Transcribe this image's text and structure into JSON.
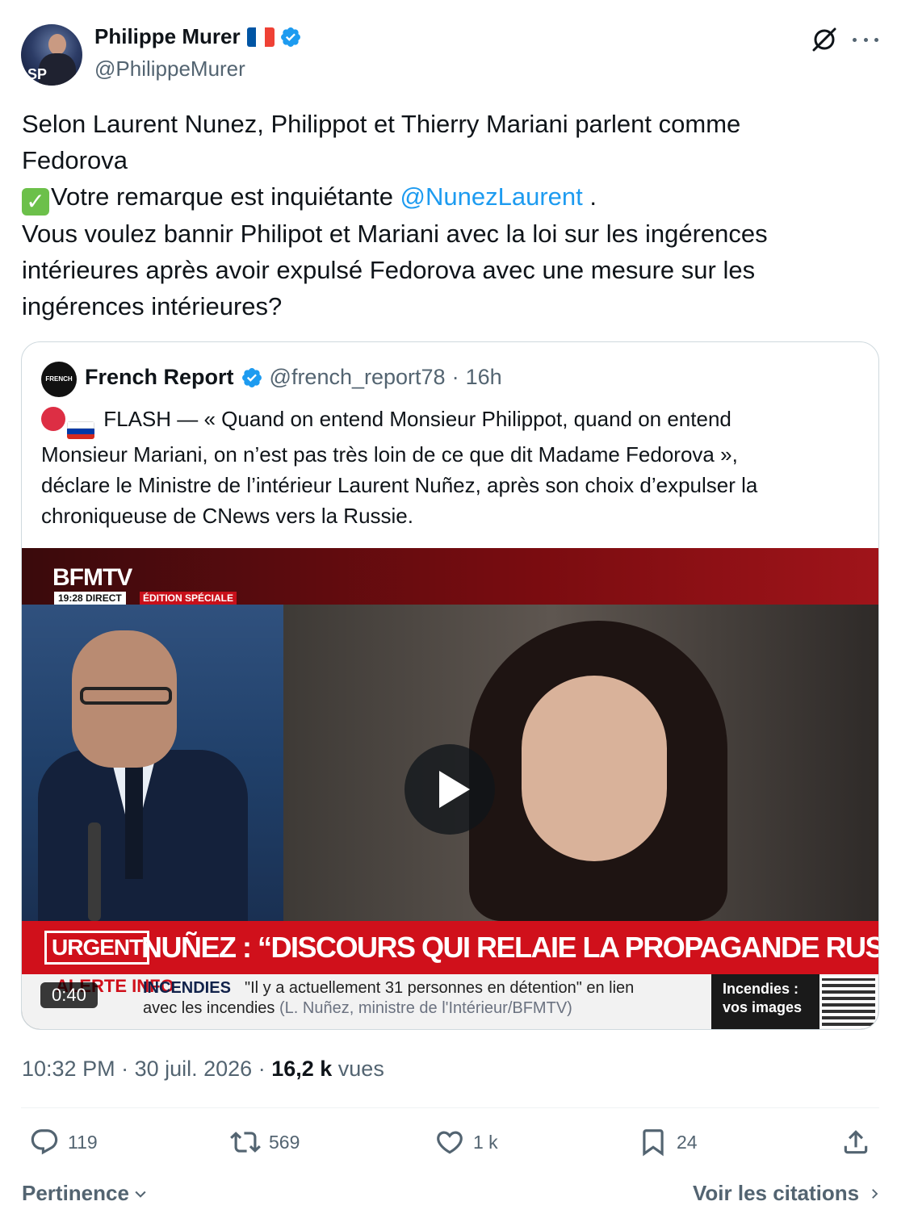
{
  "author": {
    "name": "Philippe Murer",
    "handle": "@PhilippeMurer",
    "avatar_text": "SP"
  },
  "tweet": {
    "line1": "Selon Laurent Nunez, Philippot et Thierry Mariani parlent comme",
    "line2": "Fedorova",
    "line3_prefix": "Votre remarque est inquiétante ",
    "line3_mention": "@NunezLaurent",
    "line3_suffix": " .",
    "line4": "Vous voulez bannir Philipot et Mariani avec la loi sur les ingérences",
    "line5": "intérieures après avoir expulsé Fedorova avec une mesure sur les",
    "line6": "ingérences intérieures?"
  },
  "quote": {
    "avatar_text": "FRENCH",
    "name": "French Report",
    "handle": "@french_report78",
    "separator": "·",
    "time": "16h",
    "line1": "FLASH — « Quand on entend Monsieur Philippot, quand on entend",
    "line2": "Monsieur Mariani, on n’est pas très loin de ce que dit Madame Fedorova »,",
    "line3": "déclare le Ministre de l’intérieur Laurent Nuñez, après son choix d’expulser la",
    "line4": "chroniqueuse de CNews vers la Russie.",
    "video": {
      "brand": "BFMTV",
      "clock": "19:28",
      "live": "DIRECT",
      "edition": "ÉDITION SPÉCIALE",
      "urgent_tag": "URGENT",
      "headline": "NUÑEZ : “DISCOURS QUI RELAIE LA PROPAGANDE RUSSE”",
      "alert_label": "ALERTE INFO",
      "ticker_topic": "INCENDIES",
      "ticker_line1": "\"Il y a actuellement 31 personnes en détention\" en lien",
      "ticker_line2": "avec les incendies",
      "ticker_source": "(L. Nuñez, ministre de l'Intérieur/BFMTV)",
      "promo": "Incendies : vos images",
      "duration": "0:40"
    }
  },
  "meta": {
    "time": "10:32 PM",
    "sep1": " · ",
    "date": "30 juil. 2026",
    "sep2": " · ",
    "views_count": "16,2 k",
    "views_label": " vues"
  },
  "actions": {
    "replies": "119",
    "reposts": "569",
    "likes": "1 k",
    "bookmarks": "24"
  },
  "footer": {
    "sort_label": "Pertinence",
    "quotes_link": "Voir les citations"
  },
  "colors": {
    "accent": "#1d9bf0",
    "text": "#0f1419",
    "muted": "#536471",
    "border": "#cfd9de"
  }
}
